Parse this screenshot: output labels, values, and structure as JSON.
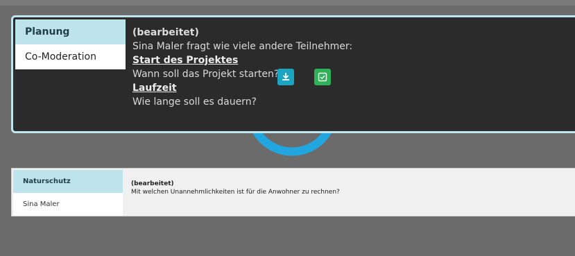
{
  "card1": {
    "tabs": [
      "Planung",
      "Co-Moderation"
    ],
    "status": "(bearbeitet)",
    "intro": "Sina Maler fragt wie viele andere Teilnehmer:",
    "q1_title": "Start des Projektes",
    "q1_text": "Wann soll das Projekt starten?",
    "q2_title": "Laufzeit",
    "q2_text": "Wie lange soll es dauern?",
    "accent_colors": {
      "download": "#1ba3c2",
      "check": "#2db258",
      "tab_active": "#bde4ea"
    }
  },
  "card2": {
    "tabs": [
      "Naturschutz",
      "Sina Maler"
    ],
    "status": "(bearbeitet)",
    "text": "Mit welchen Unannehmlichkeiten ist für die Anwohner zu rechnen?"
  }
}
